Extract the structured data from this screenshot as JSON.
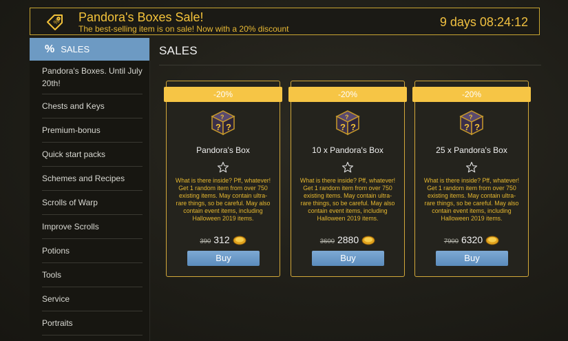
{
  "banner": {
    "title": "Pandora's Boxes Sale!",
    "subtitle": "The best-selling item is on sale! Now with a 20% discount",
    "timer": "9 days 08:24:12",
    "icon": "discount-tag-icon"
  },
  "sidebar": {
    "header": {
      "icon_text": "%",
      "label": "SALES"
    },
    "items": [
      {
        "label": "Pandora's Boxes. Until July 20th!"
      },
      {
        "label": "Chests and Keys"
      },
      {
        "label": "Premium-bonus"
      },
      {
        "label": "Quick start packs"
      },
      {
        "label": "Schemes and Recipes"
      },
      {
        "label": "Scrolls of Warp"
      },
      {
        "label": "Improve Scrolls"
      },
      {
        "label": "Potions"
      },
      {
        "label": "Tools"
      },
      {
        "label": "Service"
      },
      {
        "label": "Portraits"
      }
    ]
  },
  "main": {
    "title": "SALES",
    "cards": [
      {
        "discount": "-20%",
        "name": "Pandora's Box",
        "description": "What is there inside? Pff, whatever! Get 1 random item from over 750 existing items. May contain ultra-rare things, so be careful. May also contain event items, including Halloween 2019 items.",
        "old_price": "390",
        "price": "312",
        "buy_label": "Buy"
      },
      {
        "discount": "-20%",
        "name": "10 x Pandora's Box",
        "description": "What is there inside? Pff, whatever! Get 1 random item from over 750 existing items. May contain ultra-rare things, so be careful. May also contain event items, including Halloween 2019 items.",
        "old_price": "3600",
        "price": "2880",
        "buy_label": "Buy"
      },
      {
        "discount": "-20%",
        "name": "25 x Pandora's Box",
        "description": "What is there inside? Pff, whatever! Get 1 random item from over 750 existing items. May contain ultra-rare things, so be careful. May also contain event items, including Halloween 2019 items.",
        "old_price": "7900",
        "price": "6320",
        "buy_label": "Buy"
      }
    ]
  },
  "colors": {
    "accent_gold": "#f6c545",
    "sidebar_active": "#6d9ac3",
    "button_blue": "#5b8cbc"
  }
}
